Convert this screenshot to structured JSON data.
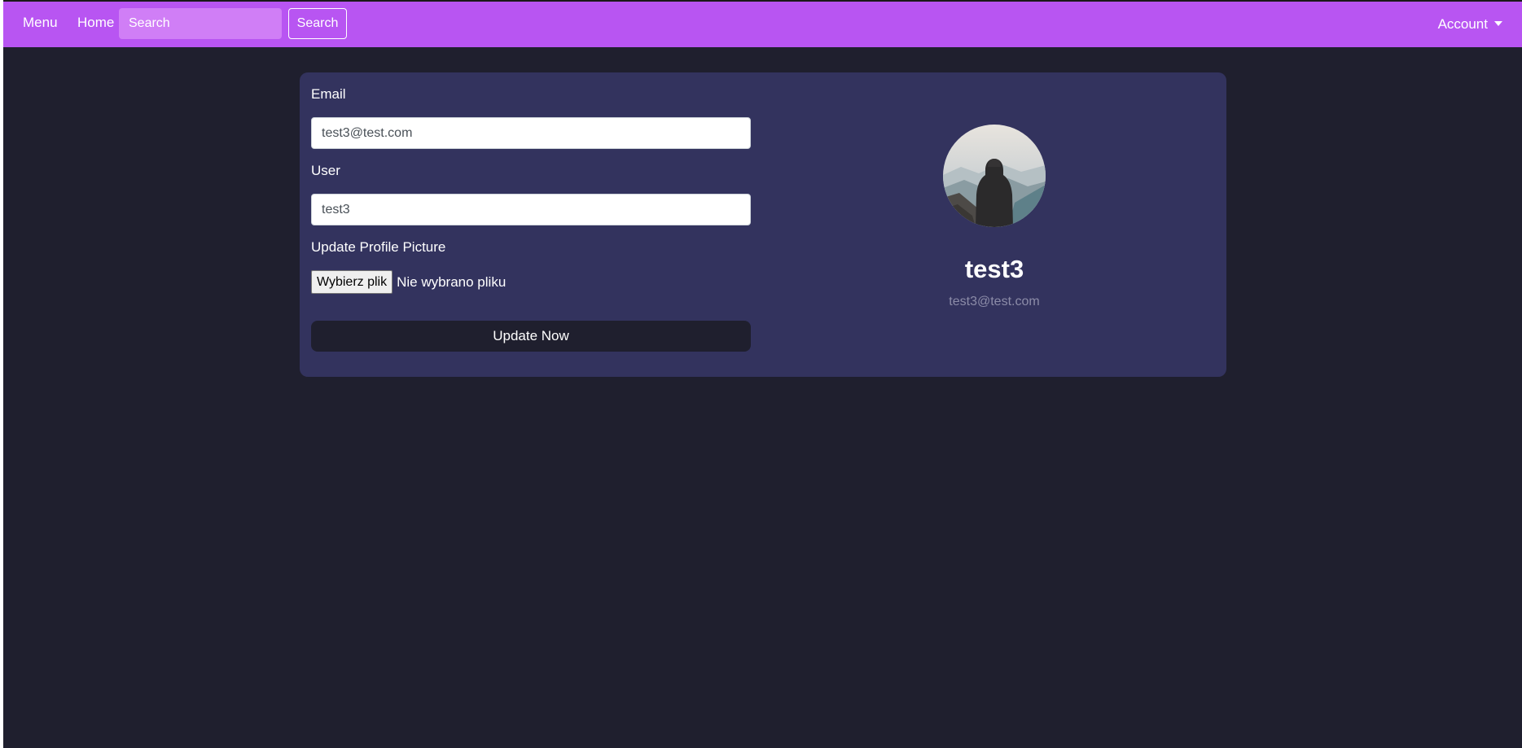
{
  "navbar": {
    "menu_label": "Menu",
    "home_label": "Home",
    "search_placeholder": "Search",
    "search_button_label": "Search",
    "account_label": "Account",
    "account_icon": "caret-down-icon"
  },
  "form": {
    "email_label": "Email",
    "email_value": "test3@test.com",
    "user_label": "User",
    "user_value": "test3",
    "picture_label": "Update Profile Picture",
    "file_button_label": "Wybierz plik",
    "file_status": "Nie wybrano pliku",
    "submit_label": "Update Now"
  },
  "profile": {
    "avatar_icon": "profile-photo-hooded-figure-mountains",
    "name": "test3",
    "email": "test3@test.com"
  },
  "colors": {
    "navbar": "#b855f2",
    "background": "#1f1f2e",
    "card": "#33335e"
  }
}
